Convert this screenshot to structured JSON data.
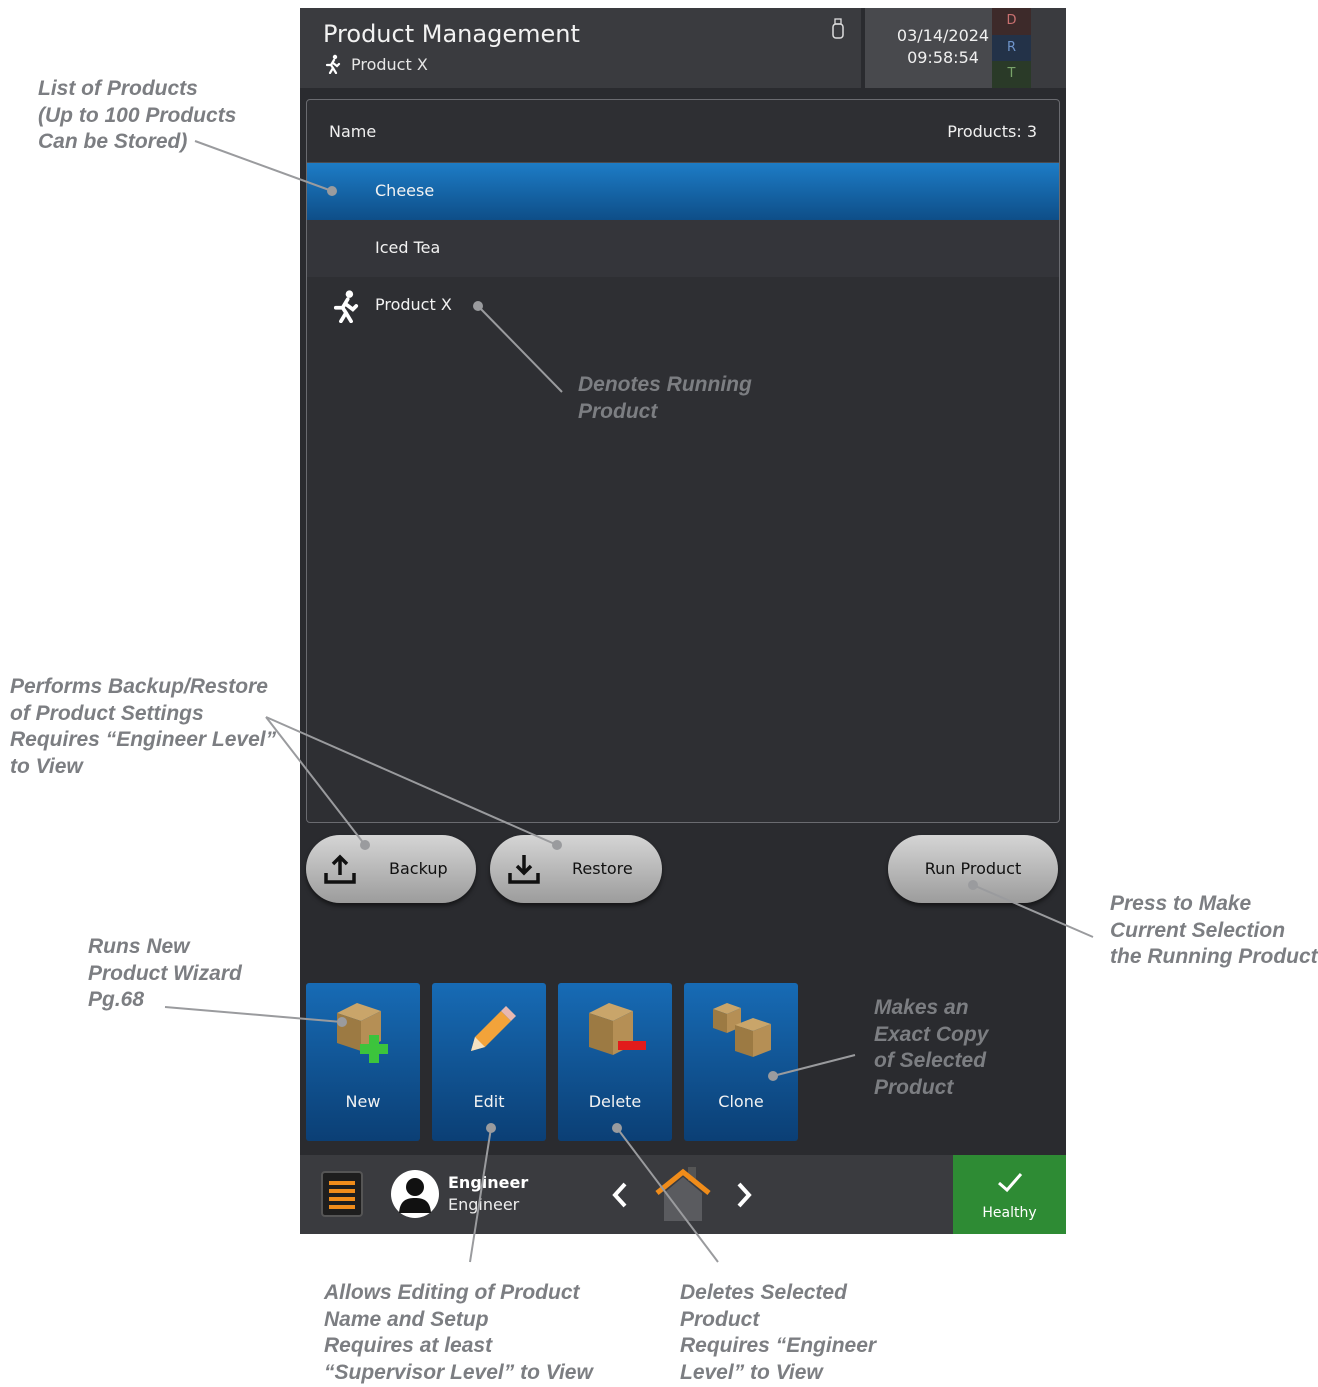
{
  "header": {
    "title": "Product Management",
    "running_product": "Product X",
    "date": "03/14/2024",
    "time": "09:58:54",
    "drt": [
      "D",
      "R",
      "T"
    ]
  },
  "list": {
    "column_name": "Name",
    "count_label": "Products: 3",
    "items": [
      {
        "label": "Cheese",
        "selected": true,
        "running": false
      },
      {
        "label": "Iced Tea",
        "selected": false,
        "running": false
      },
      {
        "label": "Product X",
        "selected": false,
        "running": true
      }
    ]
  },
  "actions": {
    "backup": "Backup",
    "restore": "Restore",
    "run_product": "Run Product"
  },
  "tiles": {
    "new": "New",
    "edit": "Edit",
    "delete": "Delete",
    "clone": "Clone"
  },
  "footer": {
    "user_name": "Engineer",
    "user_role": "Engineer",
    "status": "Healthy"
  },
  "annotations": {
    "list_of_products": "List of Products\n(Up to 100 Products\nCan be Stored)",
    "running_product": "Denotes Running\nProduct",
    "backup_restore": "Performs Backup/Restore\nof Product Settings\nRequires “Engineer Level”\nto View",
    "run_product": "Press to Make\nCurrent Selection\nthe Running Product",
    "new_wizard": "Runs New\nProduct Wizard\nPg.68",
    "clone": "Makes an\nExact Copy\nof Selected\nProduct",
    "edit": "Allows Editing of Product\nName and Setup\nRequires at least\n“Supervisor Level” to View",
    "delete": "Deletes Selected\nProduct\nRequires “Engineer\nLevel” to View"
  },
  "colors": {
    "selected_row": "#1d7cc6",
    "tile": "#176bb5",
    "healthy": "#2e8b34",
    "annotation": "#7c7e82"
  }
}
